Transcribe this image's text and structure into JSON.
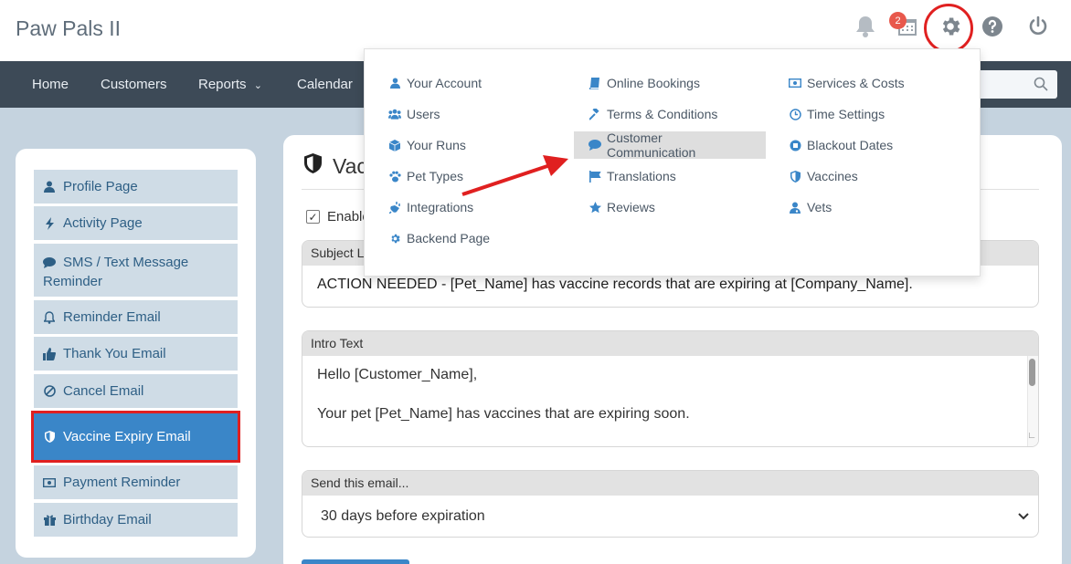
{
  "app": {
    "title": "Paw Pals II"
  },
  "header": {
    "notification_count": "2"
  },
  "nav": {
    "items": [
      "Home",
      "Customers",
      "Reports",
      "Calendar"
    ],
    "search": {
      "placeholder": ""
    }
  },
  "settings_menu": {
    "col1": [
      "Your Account",
      "Users",
      "Your Runs",
      "Pet Types",
      "Integrations",
      "Backend Page"
    ],
    "col2": [
      "Online Bookings",
      "Terms & Conditions",
      "Customer Communication",
      "Translations",
      "Reviews"
    ],
    "col3": [
      "Services & Costs",
      "Time Settings",
      "Blackout Dates",
      "Vaccines",
      "Vets"
    ],
    "highlighted": "Customer Communication"
  },
  "sidebar": {
    "items": [
      {
        "label": "Profile Page",
        "icon": "user-icon"
      },
      {
        "label": "Activity Page",
        "icon": "bolt-icon"
      },
      {
        "label": "SMS / Text Message Reminder",
        "icon": "comment-icon"
      },
      {
        "label": "Reminder Email",
        "icon": "bell-icon"
      },
      {
        "label": "Thank You Email",
        "icon": "thumbs-up-icon"
      },
      {
        "label": "Cancel Email",
        "icon": "ban-icon"
      },
      {
        "label": "Vaccine Expiry Email",
        "icon": "shield-icon",
        "active": true
      },
      {
        "label": "Payment Reminder",
        "icon": "money-icon"
      },
      {
        "label": "Birthday Email",
        "icon": "gift-icon"
      }
    ]
  },
  "main": {
    "title": "Vac",
    "enable_label": "Enable",
    "subject": {
      "label": "Subject L",
      "value": "ACTION NEEDED - [Pet_Name] has vaccine records that are expiring at [Company_Name]."
    },
    "intro": {
      "label": "Intro Text",
      "line1": "Hello [Customer_Name],",
      "line2": "Your pet [Pet_Name] has vaccines that are expiring soon."
    },
    "send": {
      "label": "Send this email...",
      "selected": "30 days before expiration"
    }
  },
  "colors": {
    "accent": "#3a86c8",
    "highlight_red": "#e02020",
    "navbar": "#3d4a57",
    "badge": "#e8584c"
  }
}
